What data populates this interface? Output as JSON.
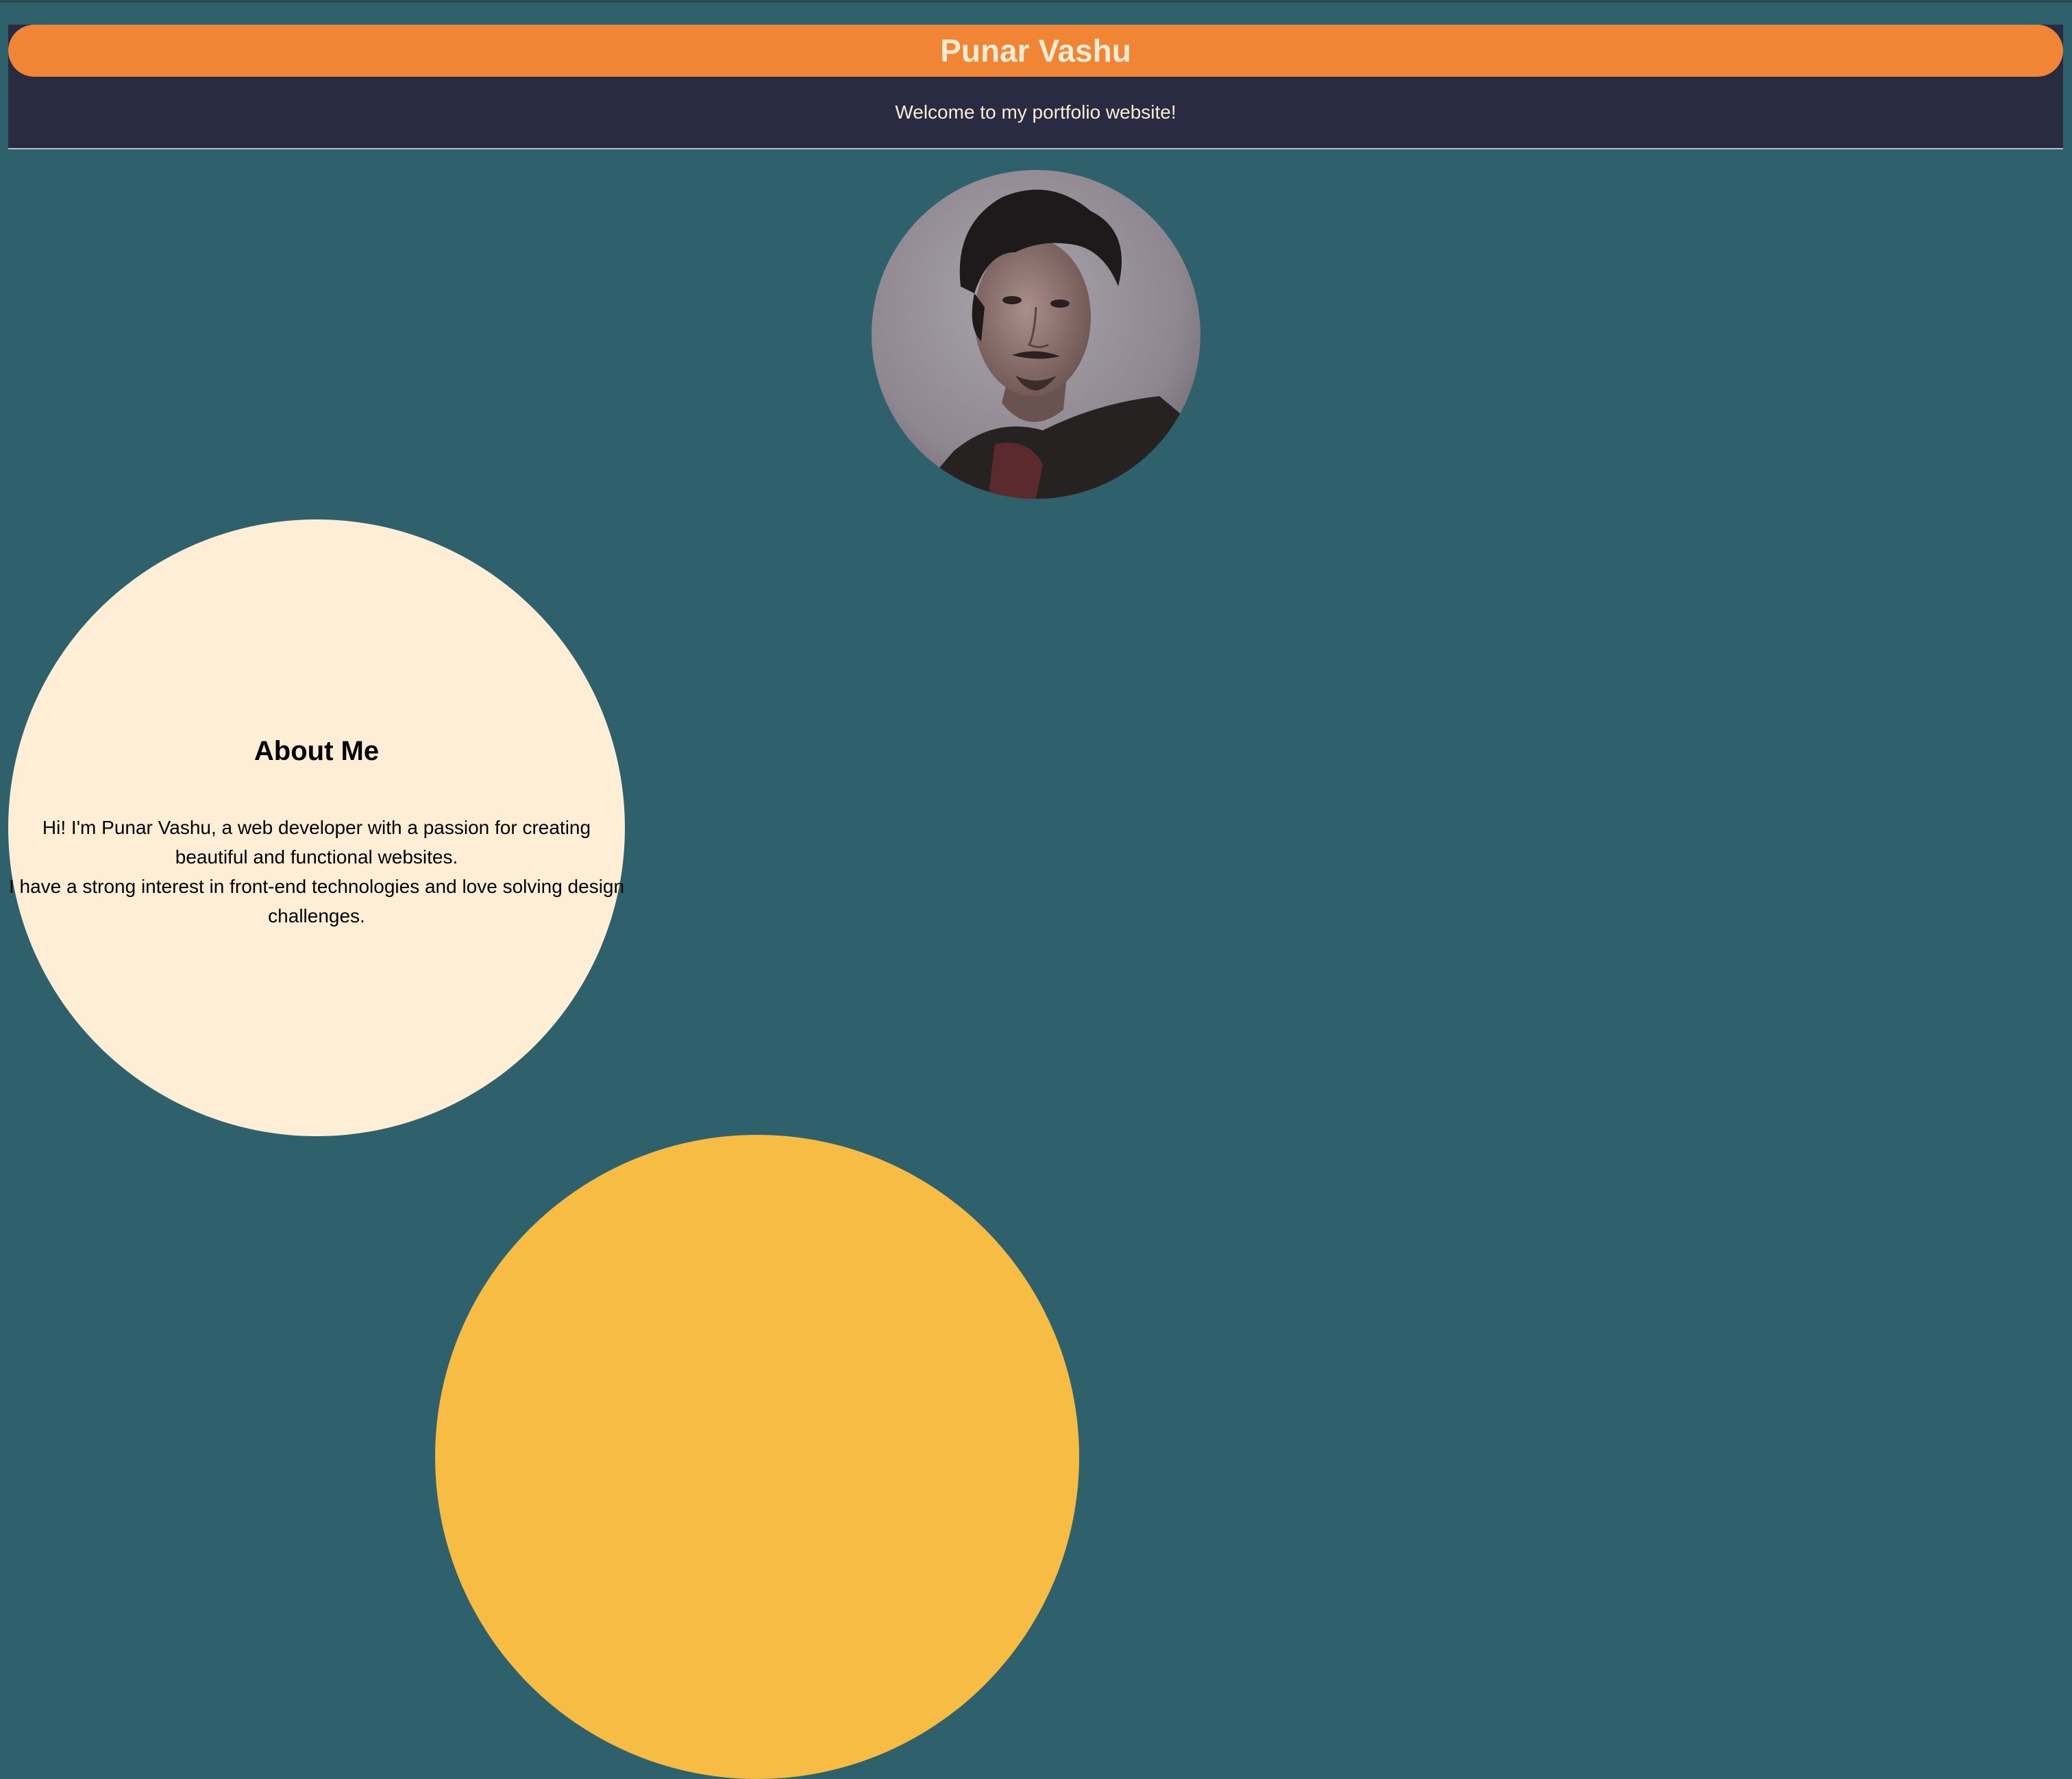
{
  "header": {
    "title": "Punar Vashu",
    "tagline": "Welcome to my portfolio website!"
  },
  "profile": {
    "image_alt": "profile-photo"
  },
  "about": {
    "heading": "About Me",
    "line1": "Hi! I'm Punar Vashu, a web developer with a passion for creating beautiful and functional websites.",
    "line2": "I have a strong interest in front-end technologies and love solving design challenges."
  },
  "colors": {
    "background": "#2f616d",
    "header_bg": "#282b42",
    "title_bar": "#f08535",
    "title_text": "#fdebd3",
    "about_bg": "#feeed6",
    "accent_yellow": "#f6bc43"
  }
}
